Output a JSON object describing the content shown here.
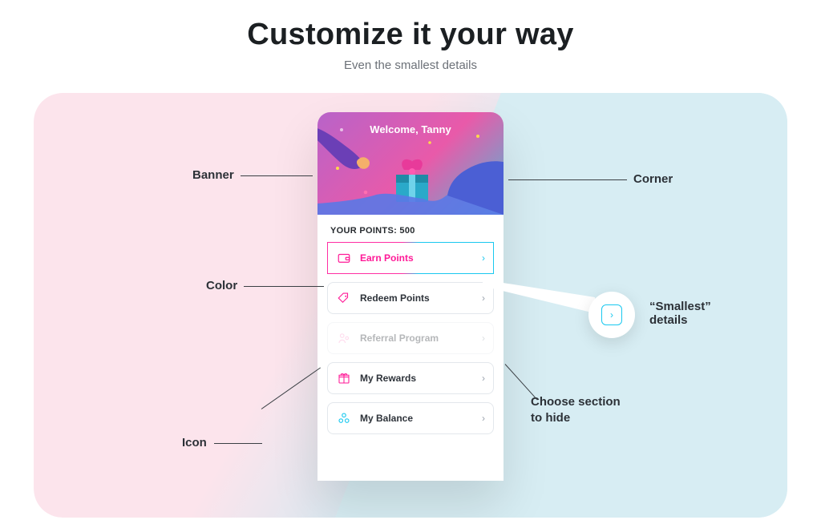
{
  "hero": {
    "title": "Customize it your way",
    "subtitle": "Even the smallest details"
  },
  "callouts": {
    "banner": "Banner",
    "color": "Color",
    "icon": "Icon",
    "corner": "Corner",
    "smallest_line1": "“Smallest”",
    "smallest_line2": "details",
    "choose_line1": "Choose section",
    "choose_line2": "to hide"
  },
  "phone": {
    "welcome": "Welcome, Tanny",
    "points_label": "YOUR POINTS: 500",
    "tiles": {
      "earn": "Earn Points",
      "redeem": "Redeem Points",
      "referral": "Referral Program",
      "rewards": "My Rewards",
      "balance": "My Balance"
    }
  },
  "colors": {
    "pink": "#ff1a97",
    "cyan": "#19c8ef"
  }
}
